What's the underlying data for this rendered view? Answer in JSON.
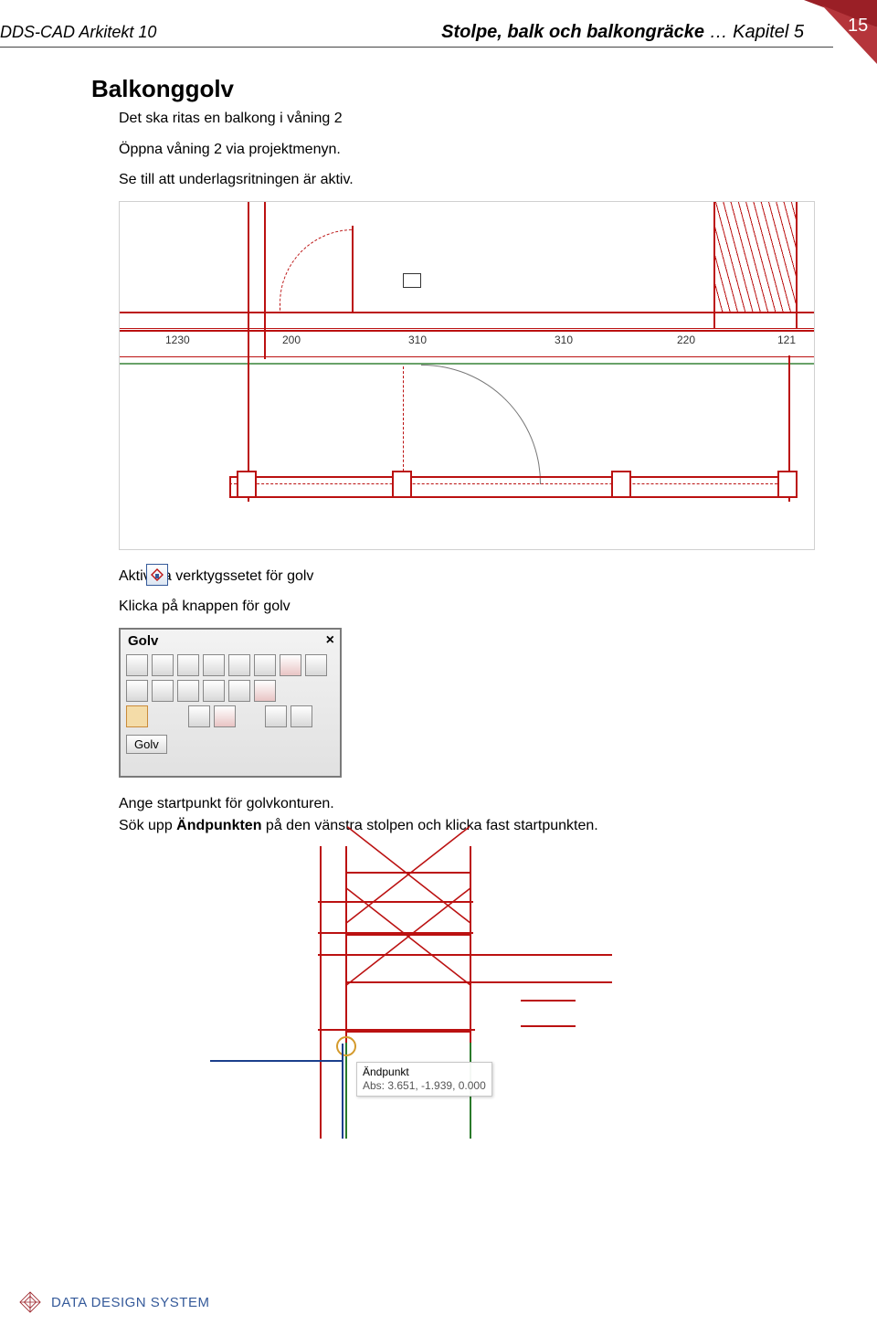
{
  "header": {
    "left": "DDS-CAD Arkitekt 10",
    "right_bold": "Stolpe, balk och balkongräcke",
    "right_chapter": " … Kapitel 5",
    "page_number": "15"
  },
  "section": {
    "title": "Balkonggolv",
    "p1": "Det ska ritas en balkong i våning 2",
    "p2": "Öppna våning 2 via projektmenyn.",
    "p3": "Se till att underlagsritningen är aktiv."
  },
  "drawing1": {
    "dims": [
      "1230",
      "200",
      "310",
      "310",
      "220",
      "121"
    ]
  },
  "after_drawing1": {
    "line1": "Aktivera verktygssetet för golv",
    "line2": "Klicka på knappen för golv"
  },
  "tool_panel": {
    "title": "Golv",
    "button": "Golv"
  },
  "after_panel": {
    "line1": "Ange startpunkt för golvkonturen.",
    "line2a": "Sök upp ",
    "line2b_bold": "Ändpunkten",
    "line2c": " på den vänstra stolpen och klicka fast startpunkten."
  },
  "drawing2": {
    "tooltip_title": "Ändpunkt",
    "tooltip_abs": "Abs: 3.651, -1.939, 0.000"
  },
  "footer": {
    "brand": "DATA DESIGN SYSTEM"
  }
}
